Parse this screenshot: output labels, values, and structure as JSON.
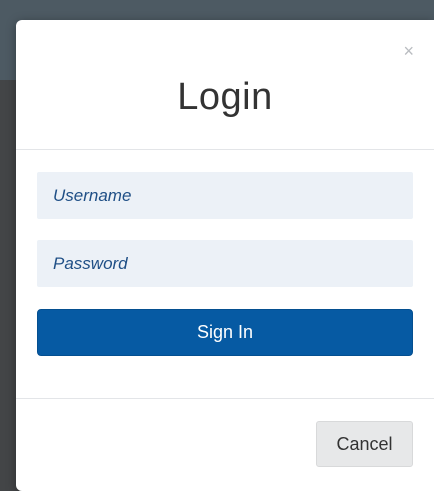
{
  "modal": {
    "title": "Login",
    "close_label": "×",
    "username": {
      "placeholder": "Username",
      "value": ""
    },
    "password": {
      "placeholder": "Password",
      "value": ""
    },
    "signin_label": "Sign In",
    "cancel_label": "Cancel"
  },
  "colors": {
    "primary": "#065aa3",
    "field_background": "#ecf1f7",
    "placeholder_text": "#1f4f86",
    "cancel_background": "#e7e8e9"
  },
  "icons": {
    "close": "close-icon"
  }
}
